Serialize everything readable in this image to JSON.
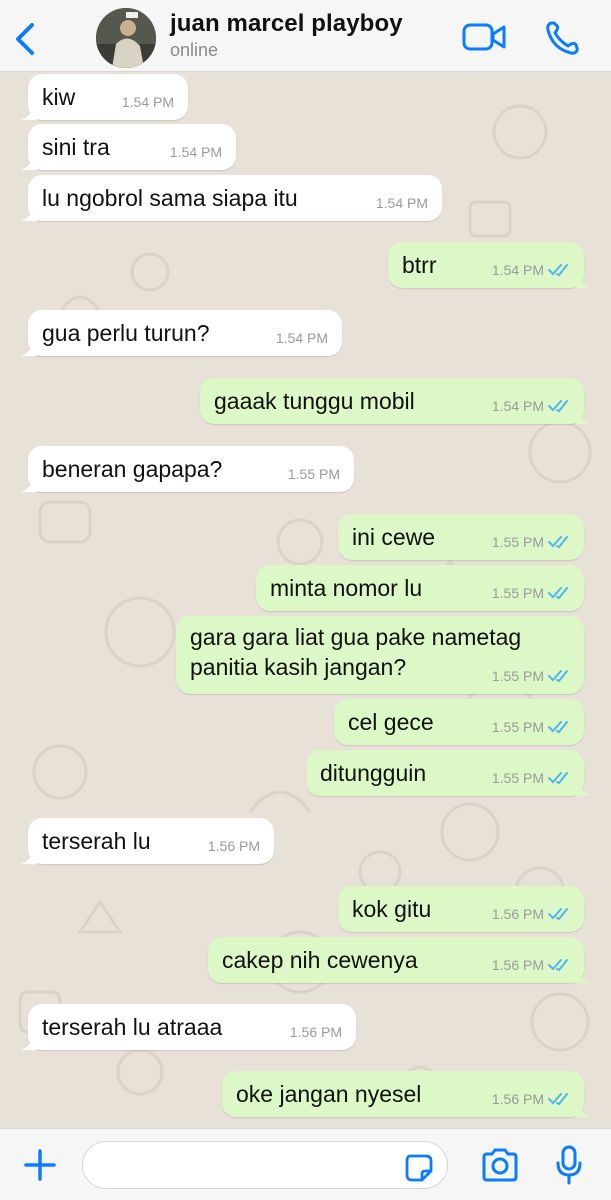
{
  "header": {
    "back_label": "",
    "contact_name": "juan marcel playboy",
    "status": "online",
    "accent_color": "#0a7cff"
  },
  "messages": [
    {
      "dir": "in",
      "text": "kiw",
      "time": "1.54 PM"
    },
    {
      "dir": "in",
      "text": "sini tra",
      "time": "1.54 PM"
    },
    {
      "dir": "in",
      "text": "lu ngobrol sama siapa itu",
      "time": "1.54 PM"
    },
    {
      "dir": "out",
      "text": "btrr",
      "time": "1.54 PM",
      "read": true
    },
    {
      "dir": "in",
      "text": "gua perlu turun?",
      "time": "1.54 PM"
    },
    {
      "dir": "out",
      "text": "gaaak tunggu mobil",
      "time": "1.54 PM",
      "read": true
    },
    {
      "dir": "in",
      "text": "beneran gapapa?",
      "time": "1.55 PM"
    },
    {
      "dir": "out",
      "text": "ini cewe",
      "time": "1.55 PM",
      "read": true
    },
    {
      "dir": "out",
      "text": "minta nomor lu",
      "time": "1.55 PM",
      "read": true
    },
    {
      "dir": "out",
      "text": "gara gara liat gua pake nametag\npanitia kasih jangan?",
      "time": "1.55 PM",
      "read": true
    },
    {
      "dir": "out",
      "text": "cel gece",
      "time": "1.55 PM",
      "read": true
    },
    {
      "dir": "out",
      "text": "ditungguin",
      "time": "1.55 PM",
      "read": true
    },
    {
      "dir": "in",
      "text": "terserah lu",
      "time": "1.56 PM"
    },
    {
      "dir": "out",
      "text": "kok gitu",
      "time": "1.56 PM",
      "read": true
    },
    {
      "dir": "out",
      "text": "cakep nih cewenya",
      "time": "1.56 PM",
      "read": true
    },
    {
      "dir": "in",
      "text": "terserah lu atraaa",
      "time": "1.56 PM"
    },
    {
      "dir": "out",
      "text": "oke jangan nyesel",
      "time": "1.56 PM",
      "read": true
    }
  ],
  "composer": {
    "placeholder": "",
    "icons": [
      "plus-icon",
      "sticker-icon",
      "camera-icon",
      "microphone-icon"
    ]
  },
  "colors": {
    "incoming_bubble": "#ffffff",
    "outgoing_bubble": "#dcf8c6",
    "read_ticks": "#4fb6ec",
    "timestamp": "#9a9a9a"
  }
}
